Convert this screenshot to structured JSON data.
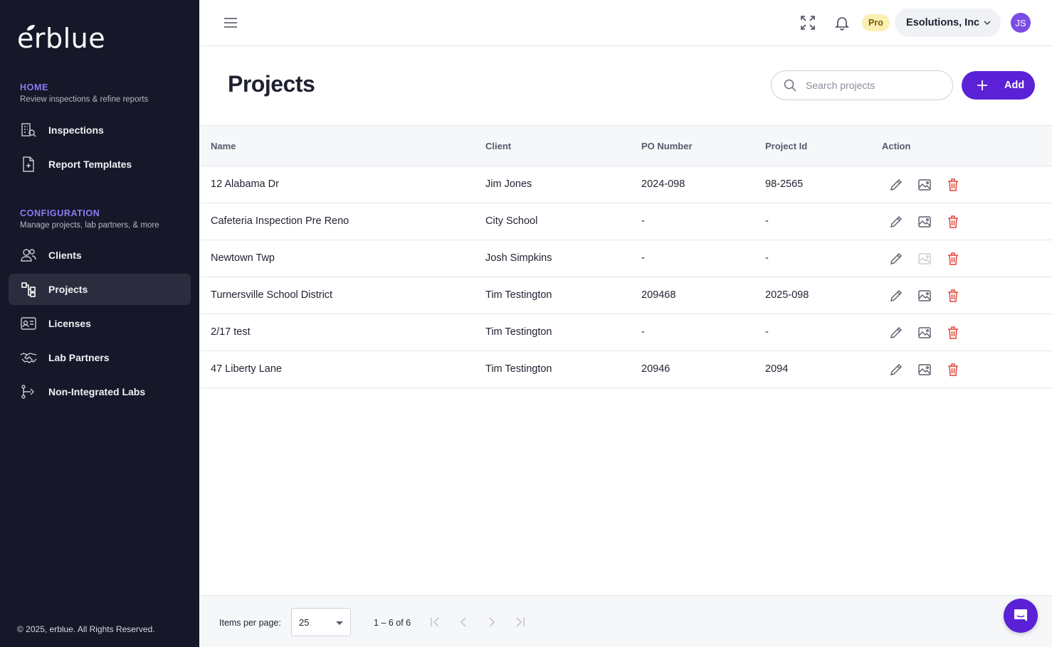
{
  "brand": {
    "name": "erblue"
  },
  "sidebar": {
    "sections": [
      {
        "title": "HOME",
        "subtitle": "Review inspections & refine reports"
      },
      {
        "title": "CONFIGURATION",
        "subtitle": "Manage projects, lab partners, & more"
      }
    ],
    "items": [
      {
        "label": "Inspections",
        "icon": "building-search-icon",
        "active": false
      },
      {
        "label": "Report Templates",
        "icon": "file-plus-icon",
        "active": false
      },
      {
        "label": "Clients",
        "icon": "users-icon",
        "active": false
      },
      {
        "label": "Projects",
        "icon": "hierarchy-icon",
        "active": true
      },
      {
        "label": "Licenses",
        "icon": "id-card-icon",
        "active": false
      },
      {
        "label": "Lab Partners",
        "icon": "handshake-icon",
        "active": false
      },
      {
        "label": "Non-Integrated Labs",
        "icon": "share-branch-icon",
        "active": false
      }
    ],
    "copyright": "© 2025, erblue. All Rights Reserved."
  },
  "topbar": {
    "plan_badge": "Pro",
    "organization": "Esolutions, Inc",
    "avatar_initials": "JS"
  },
  "page": {
    "title": "Projects",
    "search_placeholder": "Search projects",
    "add_label": "Add"
  },
  "table": {
    "columns": [
      "Name",
      "Client",
      "PO Number",
      "Project Id",
      "Action"
    ],
    "rows": [
      {
        "name": "12 Alabama Dr",
        "client": "Jim Jones",
        "po_number": "2024-098",
        "project_id": "98-2565",
        "image_enabled": true
      },
      {
        "name": "Cafeteria Inspection Pre Reno",
        "client": "City School",
        "po_number": "-",
        "project_id": "-",
        "image_enabled": true
      },
      {
        "name": "Newtown Twp",
        "client": "Josh Simpkins",
        "po_number": "-",
        "project_id": "-",
        "image_enabled": false
      },
      {
        "name": "Turnersville School District",
        "client": "Tim Testington",
        "po_number": "209468",
        "project_id": "2025-098",
        "image_enabled": true
      },
      {
        "name": "2/17 test",
        "client": "Tim Testington",
        "po_number": "-",
        "project_id": "-",
        "image_enabled": true
      },
      {
        "name": "47 Liberty Lane",
        "client": "Tim Testington",
        "po_number": "20946",
        "project_id": "2094",
        "image_enabled": true
      }
    ]
  },
  "pager": {
    "items_per_page_label": "Items per page:",
    "items_per_page": "25",
    "range": "1 – 6 of 6"
  },
  "colors": {
    "sidebar_bg": "#161728",
    "accent": "#5b21d6",
    "section_title": "#8b7cf6",
    "delete": "#e0453a",
    "pro_badge_bg": "#fbefb3"
  }
}
